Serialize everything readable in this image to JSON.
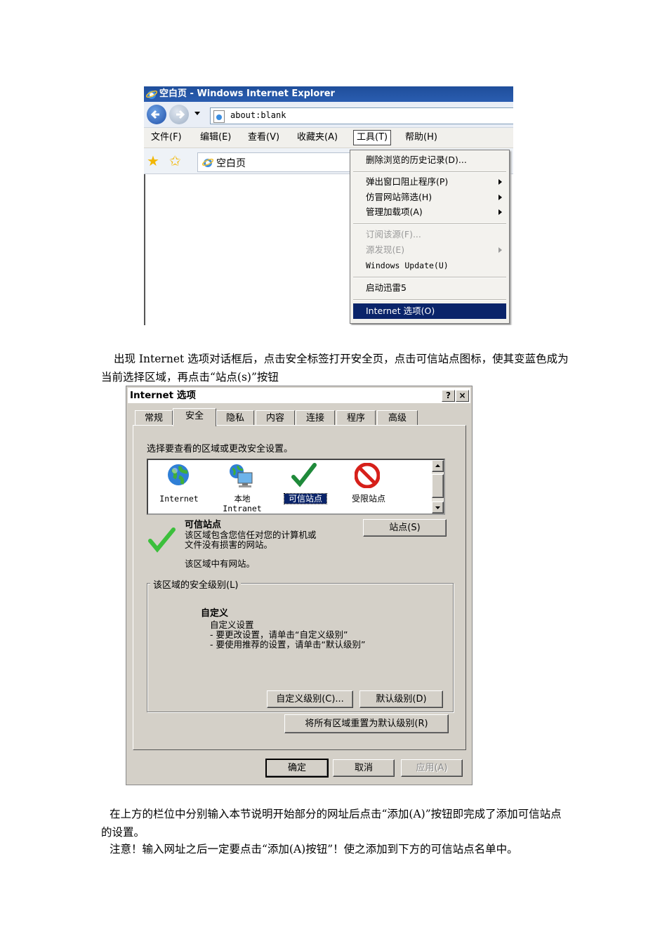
{
  "ie": {
    "title": "空白页 - Windows Internet Explorer",
    "address": "about:blank",
    "menu": [
      "文件(F)",
      "编辑(E)",
      "查看(V)",
      "收藏夹(A)",
      "工具(T)",
      "帮助(H)"
    ],
    "tab_label": "空白页",
    "tools_menu": [
      "删除浏览的历史记录(D)...",
      "弹出窗口阻止程序(P)",
      "仿冒网站筛选(H)",
      "管理加载项(A)",
      "订阅该源(F)...",
      "源发现(E)",
      "Windows Update(U)",
      "启动迅雷5",
      "Internet 选项(O)"
    ]
  },
  "paragraph1": "出现 Internet 选项对话框后，点击安全标签打开安全页，点击可信站点图标，使其变蓝色成为当前选择区域，再点击“站点(s)”按钮",
  "dialog": {
    "title": "Internet 选项",
    "help_btn": "?",
    "close_btn": "×",
    "tabs": [
      "常规",
      "安全",
      "隐私",
      "内容",
      "连接",
      "程序",
      "高级"
    ],
    "instruction": "选择要查看的区域或更改安全设置。",
    "zones": [
      "Internet",
      "本地\nIntranet",
      "可信站点",
      "受限站点"
    ],
    "zone_title": "可信站点",
    "zone_desc": "该区域包含您信任对您的计算机或\n文件没有损害的网站。",
    "zone_has_sites": "该区域中有网站。",
    "sites_btn": "站点(S)",
    "security_group": "该区域的安全级别(L)",
    "level_name": "自定义",
    "level_desc": "自定义设置\n- 要更改设置，请单击“自定义级别”\n- 要使用推荐的设置，请单击“默认级别”",
    "custom_btn": "自定义级别(C)...",
    "default_btn": "默认级别(D)",
    "reset_btn": "将所有区域重置为默认级别(R)",
    "ok_btn": "确定",
    "cancel_btn": "取消",
    "apply_btn": "应用(A)"
  },
  "paragraph2": "在上方的栏位中分别输入本节说明开始部分的网址后点击“添加(A)”按钮即完成了添加可信站点的设置。",
  "paragraph3": "注意！输入网址之后一定要点击“添加(A)按钮”！使之添加到下方的可信站点名单中。",
  "colors": {
    "ie_title": "#2a5db0",
    "highlight": "#0a246a",
    "dialog_bg": "#d4d0c8"
  }
}
